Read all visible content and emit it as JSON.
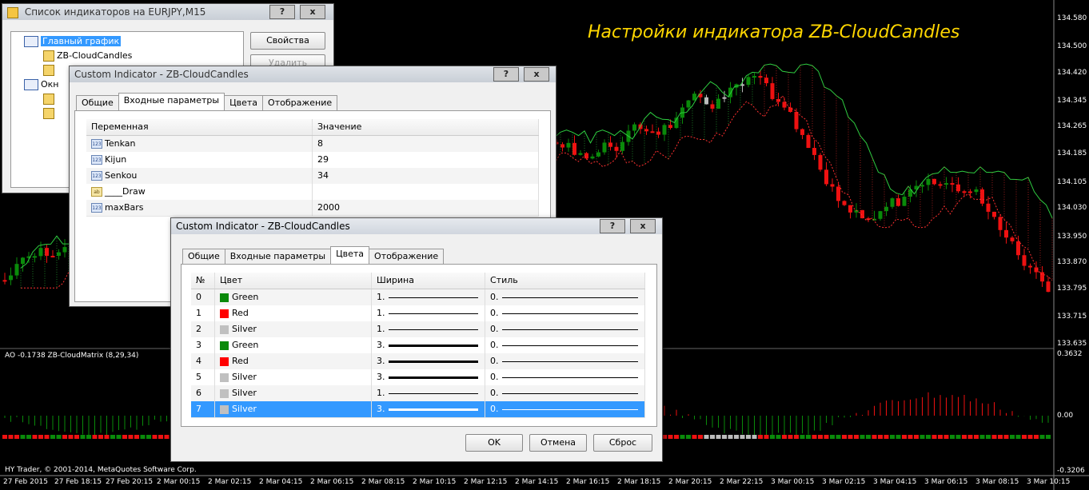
{
  "chart": {
    "overlay_title": "Настройки индикатора ZB-CloudCandles",
    "price_ticks": [
      "134.580",
      "134.500",
      "134.420",
      "134.345",
      "134.265",
      "134.185",
      "134.105",
      "134.030",
      "133.950",
      "133.870",
      "133.795",
      "133.715",
      "133.635"
    ],
    "indicator_label": "AO -0.1738  ZB-CloudMatrix (8,29,34)",
    "indicator_ticks": [
      "0.3632",
      "0.00",
      "-0.3206"
    ],
    "copyright": "HY Trader, © 2001-2014, MetaQuotes Software Corp.",
    "time_ticks": [
      "27 Feb 2015",
      "27 Feb 18:15",
      "27 Feb 20:15",
      "2 Mar 00:15",
      "2 Mar 02:15",
      "2 Mar 04:15",
      "2 Mar 06:15",
      "2 Mar 08:15",
      "2 Mar 10:15",
      "2 Mar 12:15",
      "2 Mar 14:15",
      "2 Mar 16:15",
      "2 Mar 18:15",
      "2 Mar 20:15",
      "2 Mar 22:15",
      "3 Mar 00:15",
      "3 Mar 02:15",
      "3 Mar 04:15",
      "3 Mar 06:15",
      "3 Mar 08:15",
      "3 Mar 10:15"
    ],
    "colors": {
      "bull": "#0a8a0a",
      "bear": "#e11",
      "cloud_up": "#2ecc40",
      "cloud_down": "#ff3030",
      "neutral": "#bbbbbb",
      "title": "#ffd700"
    }
  },
  "list_window": {
    "title": "Список индикаторов на EURJPY,M15",
    "tree": [
      {
        "label": "Главный график",
        "icon": "chart-window-icon",
        "selected": true
      },
      {
        "label": "ZB-CloudCandles",
        "icon": "indicator-icon",
        "selected": false
      },
      {
        "label": "",
        "icon": "indicator-icon",
        "selected": false
      },
      {
        "label": "Окн",
        "icon": "chart-window-icon",
        "selected": false
      },
      {
        "label": "",
        "icon": "indicator-icon",
        "selected": false
      },
      {
        "label": "",
        "icon": "indicator-icon",
        "selected": false
      }
    ],
    "btn_properties": "Свойства",
    "btn_delete": "Удалить"
  },
  "inputs_window": {
    "title": "Custom Indicator - ZB-CloudCandles",
    "tabs": [
      "Общие",
      "Входные параметры",
      "Цвета",
      "Отображение"
    ],
    "selected_tab": 1,
    "col_variable": "Переменная",
    "col_value": "Значение",
    "params": [
      {
        "icon": "123",
        "name": "Tenkan",
        "value": "8"
      },
      {
        "icon": "123",
        "name": "Kijun",
        "value": "29"
      },
      {
        "icon": "123",
        "name": "Senkou",
        "value": "34"
      },
      {
        "icon": "ab",
        "name": "____Draw",
        "value": ""
      },
      {
        "icon": "123",
        "name": "maxBars",
        "value": "2000"
      }
    ]
  },
  "colors_window": {
    "title": "Custom Indicator - ZB-CloudCandles",
    "tabs": [
      "Общие",
      "Входные параметры",
      "Цвета",
      "Отображение"
    ],
    "selected_tab": 2,
    "col_num": "№",
    "col_color": "Цвет",
    "col_width": "Ширина",
    "col_style": "Стиль",
    "rows": [
      {
        "n": "0",
        "color": "Green",
        "hex": "#0a8a0a",
        "width": "1.",
        "w": 1,
        "style": "0."
      },
      {
        "n": "1",
        "color": "Red",
        "hex": "#ff0000",
        "width": "1.",
        "w": 1,
        "style": "0."
      },
      {
        "n": "2",
        "color": "Silver",
        "hex": "#c0c0c0",
        "width": "1.",
        "w": 1,
        "style": "0."
      },
      {
        "n": "3",
        "color": "Green",
        "hex": "#0a8a0a",
        "width": "3.",
        "w": 3,
        "style": "0."
      },
      {
        "n": "4",
        "color": "Red",
        "hex": "#ff0000",
        "width": "3.",
        "w": 3,
        "style": "0."
      },
      {
        "n": "5",
        "color": "Silver",
        "hex": "#c0c0c0",
        "width": "3.",
        "w": 3,
        "style": "0."
      },
      {
        "n": "6",
        "color": "Silver",
        "hex": "#c0c0c0",
        "width": "1.",
        "w": 1,
        "style": "0."
      },
      {
        "n": "7",
        "color": "Silver",
        "hex": "#c0c0c0",
        "width": "3.",
        "w": 3,
        "style": "0."
      }
    ],
    "selected_row": 7,
    "btn_ok": "OK",
    "btn_cancel": "Отмена",
    "btn_reset": "Сброс"
  },
  "titlebar": {
    "help": "?",
    "close": "x"
  }
}
